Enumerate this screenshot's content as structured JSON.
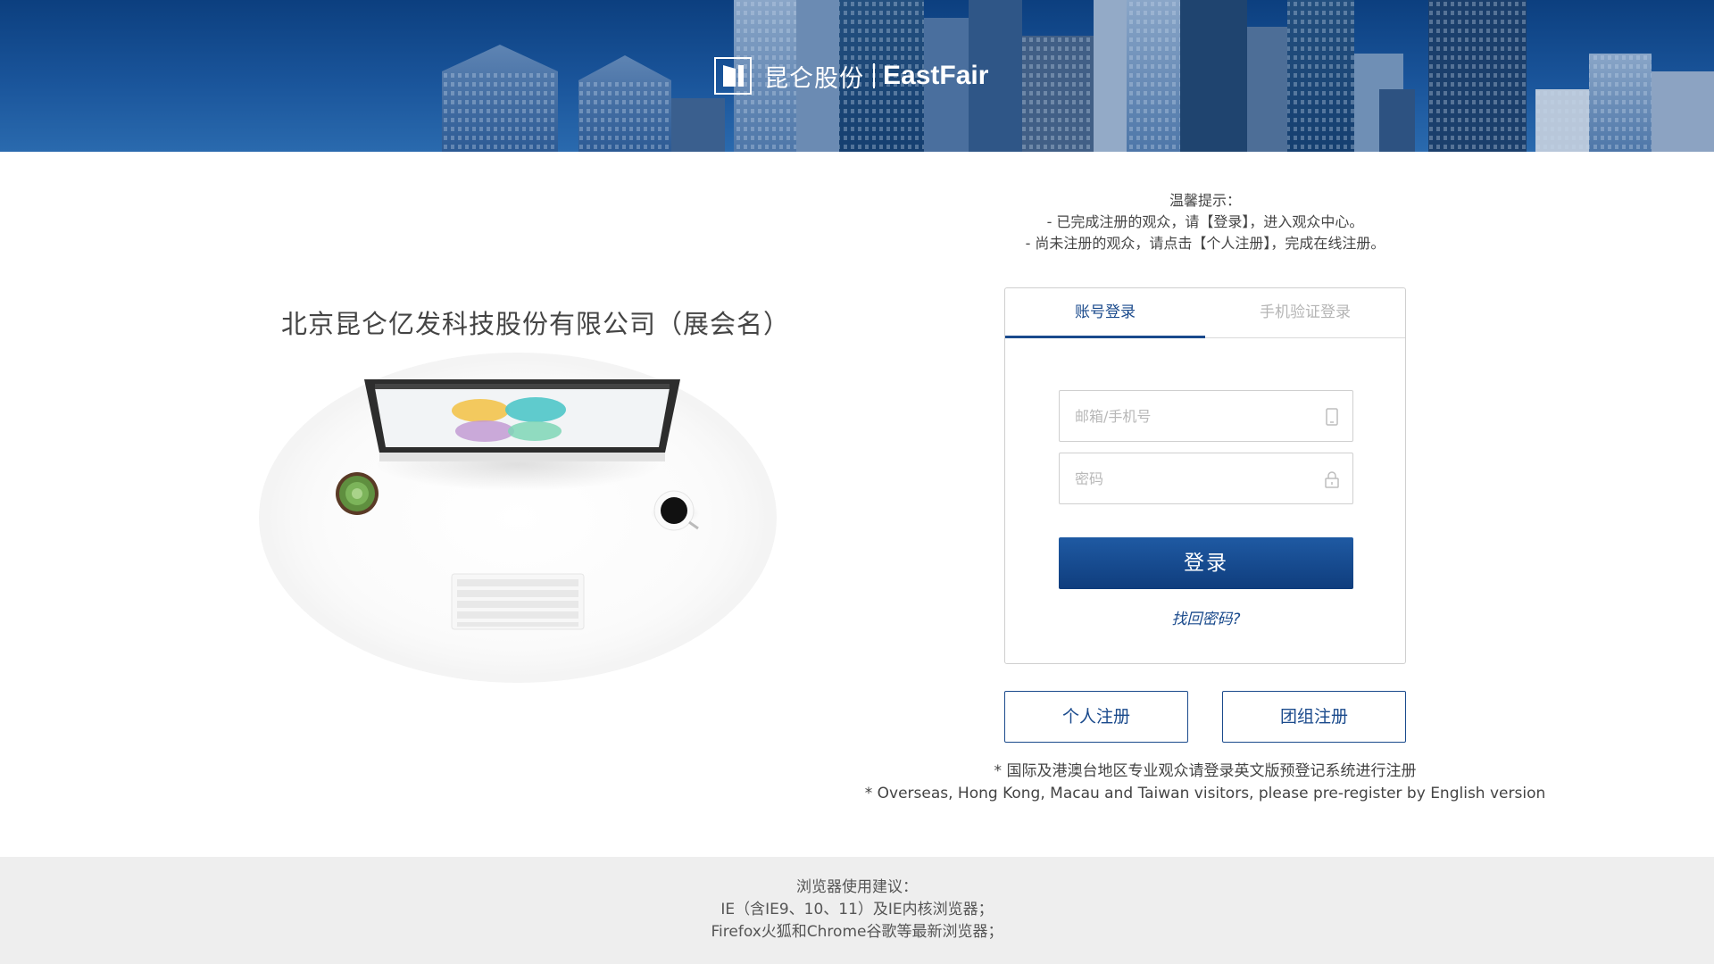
{
  "header": {
    "logo_cn": "昆仑股份",
    "logo_en": "EastFair",
    "colors": {
      "banner": "#1a559b"
    }
  },
  "left": {
    "expo_name": "北京昆仑亿发科技股份有限公司（展会名）"
  },
  "notice": {
    "title": "温馨提示：",
    "line1": "- 已完成注册的观众，请【登录】，进入观众中心。",
    "line2": "- 尚未注册的观众，请点击【个人注册】，完成在线注册。"
  },
  "login": {
    "tab_account": "账号登录",
    "tab_phone": "手机验证登录",
    "account_placeholder": "邮箱/手机号",
    "password_placeholder": "密码",
    "account_icon": "mobile-phone-icon",
    "password_icon": "lock-icon",
    "submit_label": "登录",
    "forgot_label": "找回密码?",
    "accent": "#1a4a8c"
  },
  "register": {
    "personal_label": "个人注册",
    "group_label": "团组注册"
  },
  "overseas": {
    "cn": "* 国际及港澳台地区专业观众请登录英文版预登记系统进行注册",
    "en": "* Overseas, Hong Kong, Macau and Taiwan visitors, please pre-register by English version"
  },
  "footer": {
    "title": "浏览器使用建议：",
    "line1": "IE（含IE9、10、11）及IE内核浏览器；",
    "line2": "Firefox火狐和Chrome谷歌等最新浏览器；"
  }
}
